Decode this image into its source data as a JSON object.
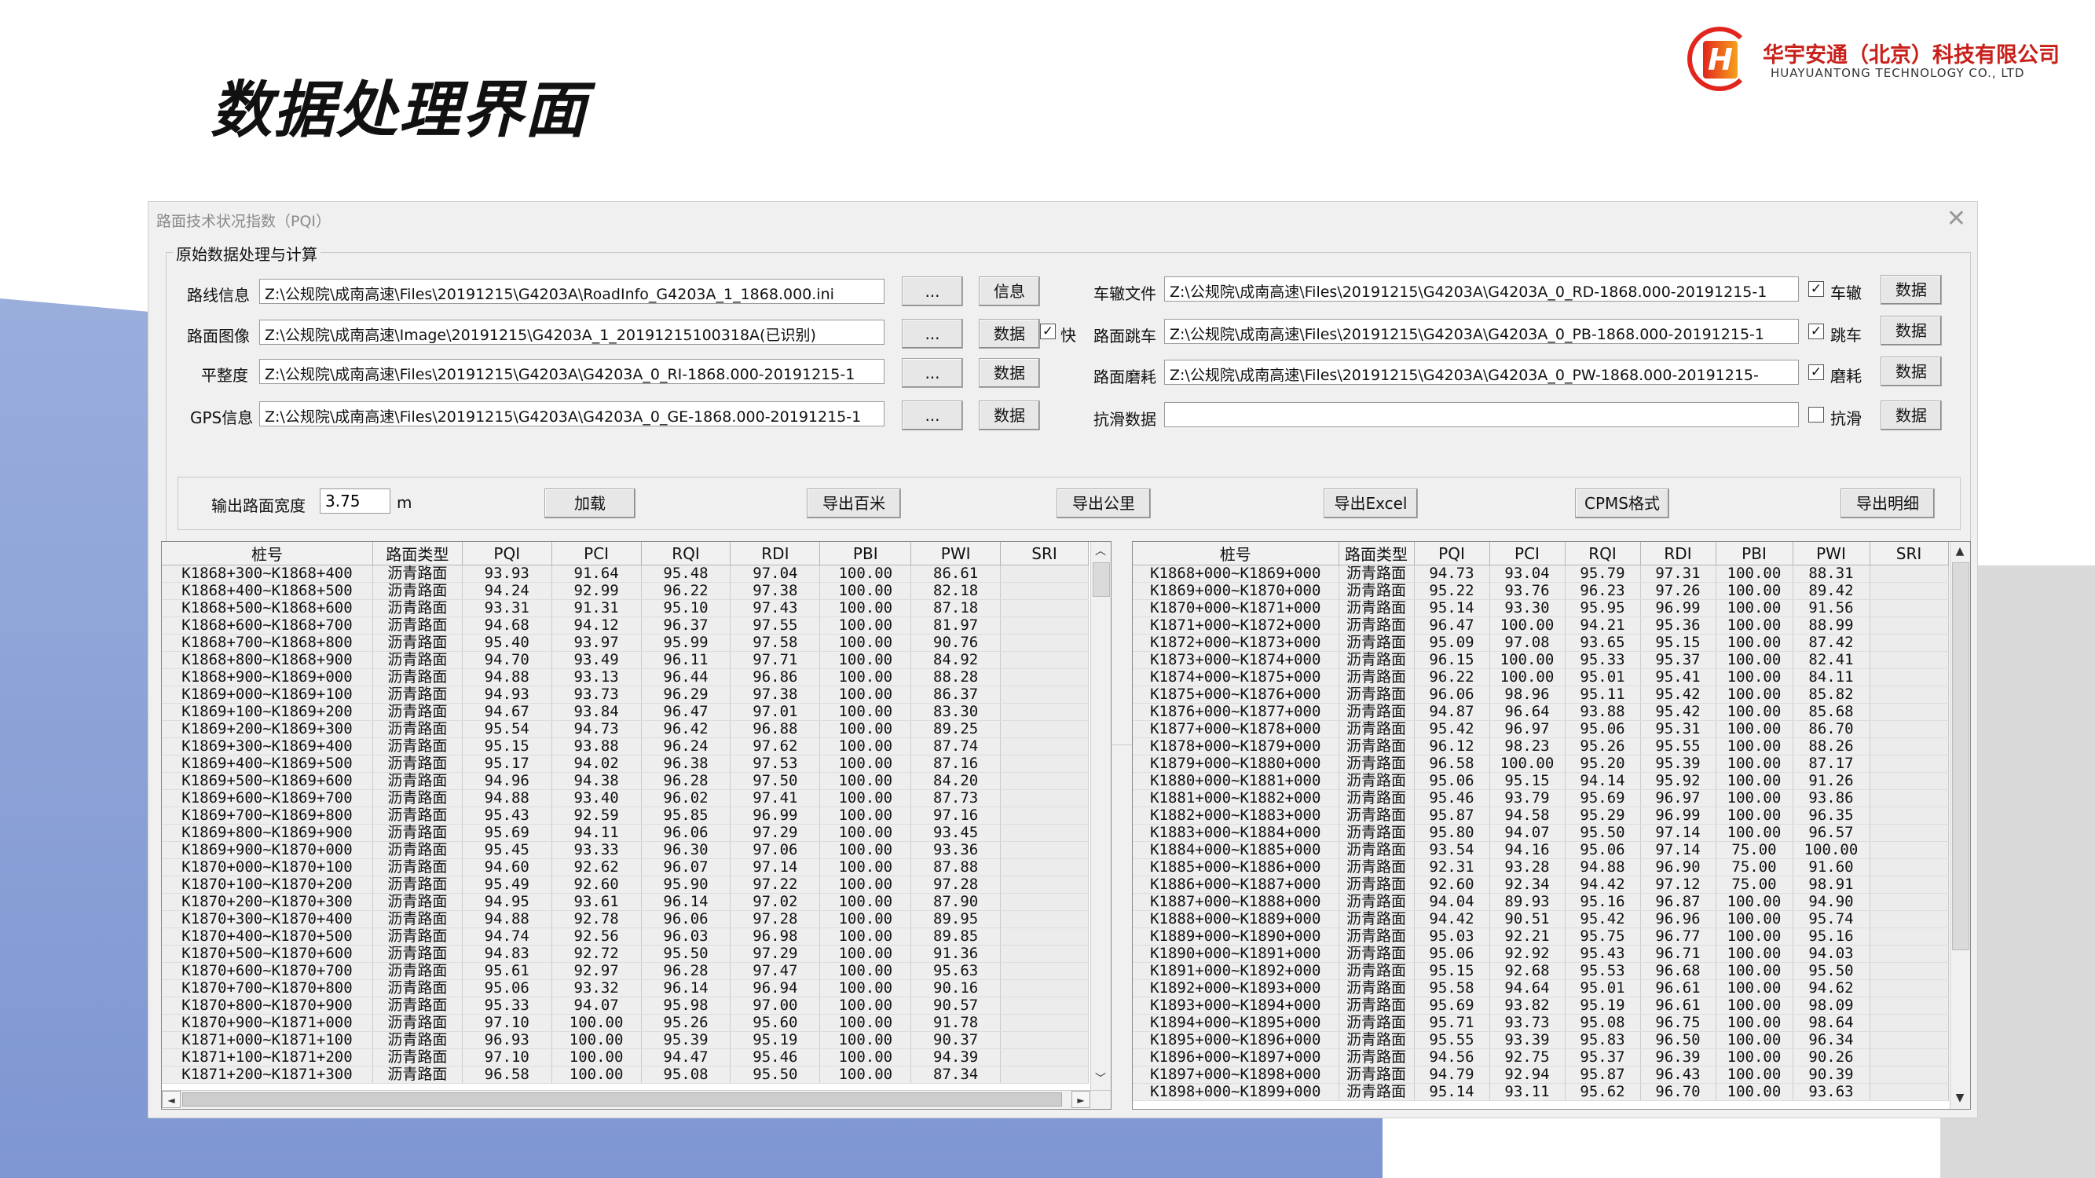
{
  "slide": {
    "title": "数据处理界面"
  },
  "logo": {
    "mark": "H",
    "cn": "华宇安通（北京）科技有限公司",
    "en": "HUAYUANTONG TECHNOLOGY CO., LTD"
  },
  "window": {
    "title": "路面技术状况指数（PQI）",
    "close": "✕"
  },
  "group": {
    "label": "原始数据处理与计算"
  },
  "left_rows": [
    {
      "label": "路线信息",
      "path": "Z:\\公规院\\成南高速\\Files\\20191215\\G4203A\\RoadInfo_G4203A_1_1868.000.ini",
      "browse": "...",
      "action": "信息"
    },
    {
      "label": "路面图像",
      "path": "Z:\\公规院\\成南高速\\Image\\20191215\\G4203A_1_20191215100318A(已识别)",
      "browse": "...",
      "action": "数据",
      "check": "快"
    },
    {
      "label": "平整度",
      "path": "Z:\\公规院\\成南高速\\Files\\20191215\\G4203A\\G4203A_0_RI-1868.000-20191215-1",
      "browse": "...",
      "action": "数据"
    },
    {
      "label": "GPS信息",
      "path": "Z:\\公规院\\成南高速\\Files\\20191215\\G4203A\\G4203A_0_GE-1868.000-20191215-1",
      "browse": "...",
      "action": "数据"
    }
  ],
  "right_rows": [
    {
      "label": "车辙文件",
      "path": "Z:\\公规院\\成南高速\\Files\\20191215\\G4203A\\G4203A_0_RD-1868.000-20191215-1",
      "check": "车辙",
      "checked": true,
      "action": "数据"
    },
    {
      "label": "路面跳车",
      "path": "Z:\\公规院\\成南高速\\Files\\20191215\\G4203A\\G4203A_0_PB-1868.000-20191215-1",
      "check": "跳车",
      "checked": true,
      "action": "数据"
    },
    {
      "label": "路面磨耗",
      "path": "Z:\\公规院\\成南高速\\Files\\20191215\\G4203A\\G4203A_0_PW-1868.000-20191215-",
      "check": "磨耗",
      "checked": true,
      "action": "数据"
    },
    {
      "label": "抗滑数据",
      "path": "",
      "check": "抗滑",
      "checked": false,
      "action": "数据"
    }
  ],
  "output": {
    "width_label": "输出路面宽度",
    "width_value": "3.75",
    "unit": "m",
    "load": "加载",
    "export_100m": "导出百米",
    "export_km": "导出公里",
    "export_excel": "导出Excel",
    "cpms": "CPMS格式",
    "export_detail": "导出明细"
  },
  "columns": [
    "桩号",
    "路面类型",
    "PQI",
    "PCI",
    "RQI",
    "RDI",
    "PBI",
    "PWI",
    "SRI"
  ],
  "left_table": [
    [
      "K1868+300~K1868+400",
      "沥青路面",
      "93.93",
      "91.64",
      "95.48",
      "97.04",
      "100.00",
      "86.61",
      ""
    ],
    [
      "K1868+400~K1868+500",
      "沥青路面",
      "94.24",
      "92.99",
      "96.22",
      "97.38",
      "100.00",
      "82.18",
      ""
    ],
    [
      "K1868+500~K1868+600",
      "沥青路面",
      "93.31",
      "91.31",
      "95.10",
      "97.43",
      "100.00",
      "87.18",
      ""
    ],
    [
      "K1868+600~K1868+700",
      "沥青路面",
      "94.68",
      "94.12",
      "96.37",
      "97.55",
      "100.00",
      "81.97",
      ""
    ],
    [
      "K1868+700~K1868+800",
      "沥青路面",
      "95.40",
      "93.97",
      "95.99",
      "97.58",
      "100.00",
      "90.76",
      ""
    ],
    [
      "K1868+800~K1868+900",
      "沥青路面",
      "94.70",
      "93.49",
      "96.11",
      "97.71",
      "100.00",
      "84.92",
      ""
    ],
    [
      "K1868+900~K1869+000",
      "沥青路面",
      "94.88",
      "93.13",
      "96.44",
      "96.86",
      "100.00",
      "88.28",
      ""
    ],
    [
      "K1869+000~K1869+100",
      "沥青路面",
      "94.93",
      "93.73",
      "96.29",
      "97.38",
      "100.00",
      "86.37",
      ""
    ],
    [
      "K1869+100~K1869+200",
      "沥青路面",
      "94.67",
      "93.84",
      "96.47",
      "97.01",
      "100.00",
      "83.30",
      ""
    ],
    [
      "K1869+200~K1869+300",
      "沥青路面",
      "95.54",
      "94.73",
      "96.42",
      "96.88",
      "100.00",
      "89.25",
      ""
    ],
    [
      "K1869+300~K1869+400",
      "沥青路面",
      "95.15",
      "93.88",
      "96.24",
      "97.62",
      "100.00",
      "87.74",
      ""
    ],
    [
      "K1869+400~K1869+500",
      "沥青路面",
      "95.17",
      "94.02",
      "96.38",
      "97.53",
      "100.00",
      "87.16",
      ""
    ],
    [
      "K1869+500~K1869+600",
      "沥青路面",
      "94.96",
      "94.38",
      "96.28",
      "97.50",
      "100.00",
      "84.20",
      ""
    ],
    [
      "K1869+600~K1869+700",
      "沥青路面",
      "94.88",
      "93.40",
      "96.02",
      "97.41",
      "100.00",
      "87.73",
      ""
    ],
    [
      "K1869+700~K1869+800",
      "沥青路面",
      "95.43",
      "92.59",
      "95.85",
      "96.99",
      "100.00",
      "97.16",
      ""
    ],
    [
      "K1869+800~K1869+900",
      "沥青路面",
      "95.69",
      "94.11",
      "96.06",
      "97.29",
      "100.00",
      "93.45",
      ""
    ],
    [
      "K1869+900~K1870+000",
      "沥青路面",
      "95.45",
      "93.33",
      "96.30",
      "97.06",
      "100.00",
      "93.36",
      ""
    ],
    [
      "K1870+000~K1870+100",
      "沥青路面",
      "94.60",
      "92.62",
      "96.07",
      "97.14",
      "100.00",
      "87.88",
      ""
    ],
    [
      "K1870+100~K1870+200",
      "沥青路面",
      "95.49",
      "92.60",
      "95.90",
      "97.22",
      "100.00",
      "97.28",
      ""
    ],
    [
      "K1870+200~K1870+300",
      "沥青路面",
      "94.95",
      "93.61",
      "96.14",
      "97.02",
      "100.00",
      "87.90",
      ""
    ],
    [
      "K1870+300~K1870+400",
      "沥青路面",
      "94.88",
      "92.78",
      "96.06",
      "97.28",
      "100.00",
      "89.95",
      ""
    ],
    [
      "K1870+400~K1870+500",
      "沥青路面",
      "94.74",
      "92.56",
      "96.03",
      "96.98",
      "100.00",
      "89.85",
      ""
    ],
    [
      "K1870+500~K1870+600",
      "沥青路面",
      "94.83",
      "92.72",
      "95.50",
      "97.29",
      "100.00",
      "91.36",
      ""
    ],
    [
      "K1870+600~K1870+700",
      "沥青路面",
      "95.61",
      "92.97",
      "96.28",
      "97.47",
      "100.00",
      "95.63",
      ""
    ],
    [
      "K1870+700~K1870+800",
      "沥青路面",
      "95.06",
      "93.32",
      "96.14",
      "96.94",
      "100.00",
      "90.16",
      ""
    ],
    [
      "K1870+800~K1870+900",
      "沥青路面",
      "95.33",
      "94.07",
      "95.98",
      "97.00",
      "100.00",
      "90.57",
      ""
    ],
    [
      "K1870+900~K1871+000",
      "沥青路面",
      "97.10",
      "100.00",
      "95.26",
      "95.60",
      "100.00",
      "91.78",
      ""
    ],
    [
      "K1871+000~K1871+100",
      "沥青路面",
      "96.93",
      "100.00",
      "95.39",
      "95.19",
      "100.00",
      "90.37",
      ""
    ],
    [
      "K1871+100~K1871+200",
      "沥青路面",
      "97.10",
      "100.00",
      "94.47",
      "95.46",
      "100.00",
      "94.39",
      ""
    ],
    [
      "K1871+200~K1871+300",
      "沥青路面",
      "96.58",
      "100.00",
      "95.08",
      "95.50",
      "100.00",
      "87.34",
      ""
    ]
  ],
  "right_table": [
    [
      "K1868+000~K1869+000",
      "沥青路面",
      "94.73",
      "93.04",
      "95.79",
      "97.31",
      "100.00",
      "88.31",
      ""
    ],
    [
      "K1869+000~K1870+000",
      "沥青路面",
      "95.22",
      "93.76",
      "96.23",
      "97.26",
      "100.00",
      "89.42",
      ""
    ],
    [
      "K1870+000~K1871+000",
      "沥青路面",
      "95.14",
      "93.30",
      "95.95",
      "96.99",
      "100.00",
      "91.56",
      ""
    ],
    [
      "K1871+000~K1872+000",
      "沥青路面",
      "96.47",
      "100.00",
      "94.21",
      "95.36",
      "100.00",
      "88.99",
      ""
    ],
    [
      "K1872+000~K1873+000",
      "沥青路面",
      "95.09",
      "97.08",
      "93.65",
      "95.15",
      "100.00",
      "87.42",
      ""
    ],
    [
      "K1873+000~K1874+000",
      "沥青路面",
      "96.15",
      "100.00",
      "95.33",
      "95.37",
      "100.00",
      "82.41",
      ""
    ],
    [
      "K1874+000~K1875+000",
      "沥青路面",
      "96.22",
      "100.00",
      "95.01",
      "95.41",
      "100.00",
      "84.11",
      ""
    ],
    [
      "K1875+000~K1876+000",
      "沥青路面",
      "96.06",
      "98.96",
      "95.11",
      "95.42",
      "100.00",
      "85.82",
      ""
    ],
    [
      "K1876+000~K1877+000",
      "沥青路面",
      "94.87",
      "96.64",
      "93.88",
      "95.42",
      "100.00",
      "85.68",
      ""
    ],
    [
      "K1877+000~K1878+000",
      "沥青路面",
      "95.42",
      "96.97",
      "95.06",
      "95.31",
      "100.00",
      "86.70",
      ""
    ],
    [
      "K1878+000~K1879+000",
      "沥青路面",
      "96.12",
      "98.23",
      "95.26",
      "95.55",
      "100.00",
      "88.26",
      ""
    ],
    [
      "K1879+000~K1880+000",
      "沥青路面",
      "96.58",
      "100.00",
      "95.20",
      "95.39",
      "100.00",
      "87.17",
      ""
    ],
    [
      "K1880+000~K1881+000",
      "沥青路面",
      "95.06",
      "95.15",
      "94.14",
      "95.92",
      "100.00",
      "91.26",
      ""
    ],
    [
      "K1881+000~K1882+000",
      "沥青路面",
      "95.46",
      "93.79",
      "95.69",
      "96.97",
      "100.00",
      "93.86",
      ""
    ],
    [
      "K1882+000~K1883+000",
      "沥青路面",
      "95.87",
      "94.58",
      "95.29",
      "96.99",
      "100.00",
      "96.35",
      ""
    ],
    [
      "K1883+000~K1884+000",
      "沥青路面",
      "95.80",
      "94.07",
      "95.50",
      "97.14",
      "100.00",
      "96.57",
      ""
    ],
    [
      "K1884+000~K1885+000",
      "沥青路面",
      "93.54",
      "94.16",
      "95.06",
      "97.14",
      "75.00",
      "100.00",
      ""
    ],
    [
      "K1885+000~K1886+000",
      "沥青路面",
      "92.31",
      "93.28",
      "94.88",
      "96.90",
      "75.00",
      "91.60",
      ""
    ],
    [
      "K1886+000~K1887+000",
      "沥青路面",
      "92.60",
      "92.34",
      "94.42",
      "97.12",
      "75.00",
      "98.91",
      ""
    ],
    [
      "K1887+000~K1888+000",
      "沥青路面",
      "94.04",
      "89.93",
      "95.16",
      "96.87",
      "100.00",
      "94.90",
      ""
    ],
    [
      "K1888+000~K1889+000",
      "沥青路面",
      "94.42",
      "90.51",
      "95.42",
      "96.96",
      "100.00",
      "95.74",
      ""
    ],
    [
      "K1889+000~K1890+000",
      "沥青路面",
      "95.03",
      "92.21",
      "95.75",
      "96.77",
      "100.00",
      "95.16",
      ""
    ],
    [
      "K1890+000~K1891+000",
      "沥青路面",
      "95.06",
      "92.92",
      "95.43",
      "96.71",
      "100.00",
      "94.03",
      ""
    ],
    [
      "K1891+000~K1892+000",
      "沥青路面",
      "95.15",
      "92.68",
      "95.53",
      "96.68",
      "100.00",
      "95.50",
      ""
    ],
    [
      "K1892+000~K1893+000",
      "沥青路面",
      "95.58",
      "94.64",
      "95.01",
      "96.61",
      "100.00",
      "94.62",
      ""
    ],
    [
      "K1893+000~K1894+000",
      "沥青路面",
      "95.69",
      "93.82",
      "95.19",
      "96.61",
      "100.00",
      "98.09",
      ""
    ],
    [
      "K1894+000~K1895+000",
      "沥青路面",
      "95.71",
      "93.73",
      "95.08",
      "96.75",
      "100.00",
      "98.64",
      ""
    ],
    [
      "K1895+000~K1896+000",
      "沥青路面",
      "95.55",
      "93.39",
      "95.83",
      "96.50",
      "100.00",
      "96.34",
      ""
    ],
    [
      "K1896+000~K1897+000",
      "沥青路面",
      "94.56",
      "92.75",
      "95.37",
      "96.39",
      "100.00",
      "90.26",
      ""
    ],
    [
      "K1897+000~K1898+000",
      "沥青路面",
      "94.79",
      "92.94",
      "95.87",
      "96.43",
      "100.00",
      "90.39",
      ""
    ],
    [
      "K1898+000~K1899+000",
      "沥青路面",
      "95.14",
      "93.11",
      "95.62",
      "96.70",
      "100.00",
      "93.63",
      ""
    ]
  ],
  "scroll": {
    "up": "▲",
    "down": "▼",
    "left": "◄",
    "right": "►",
    "chev_up": "︿",
    "chev_down": "﹀"
  }
}
